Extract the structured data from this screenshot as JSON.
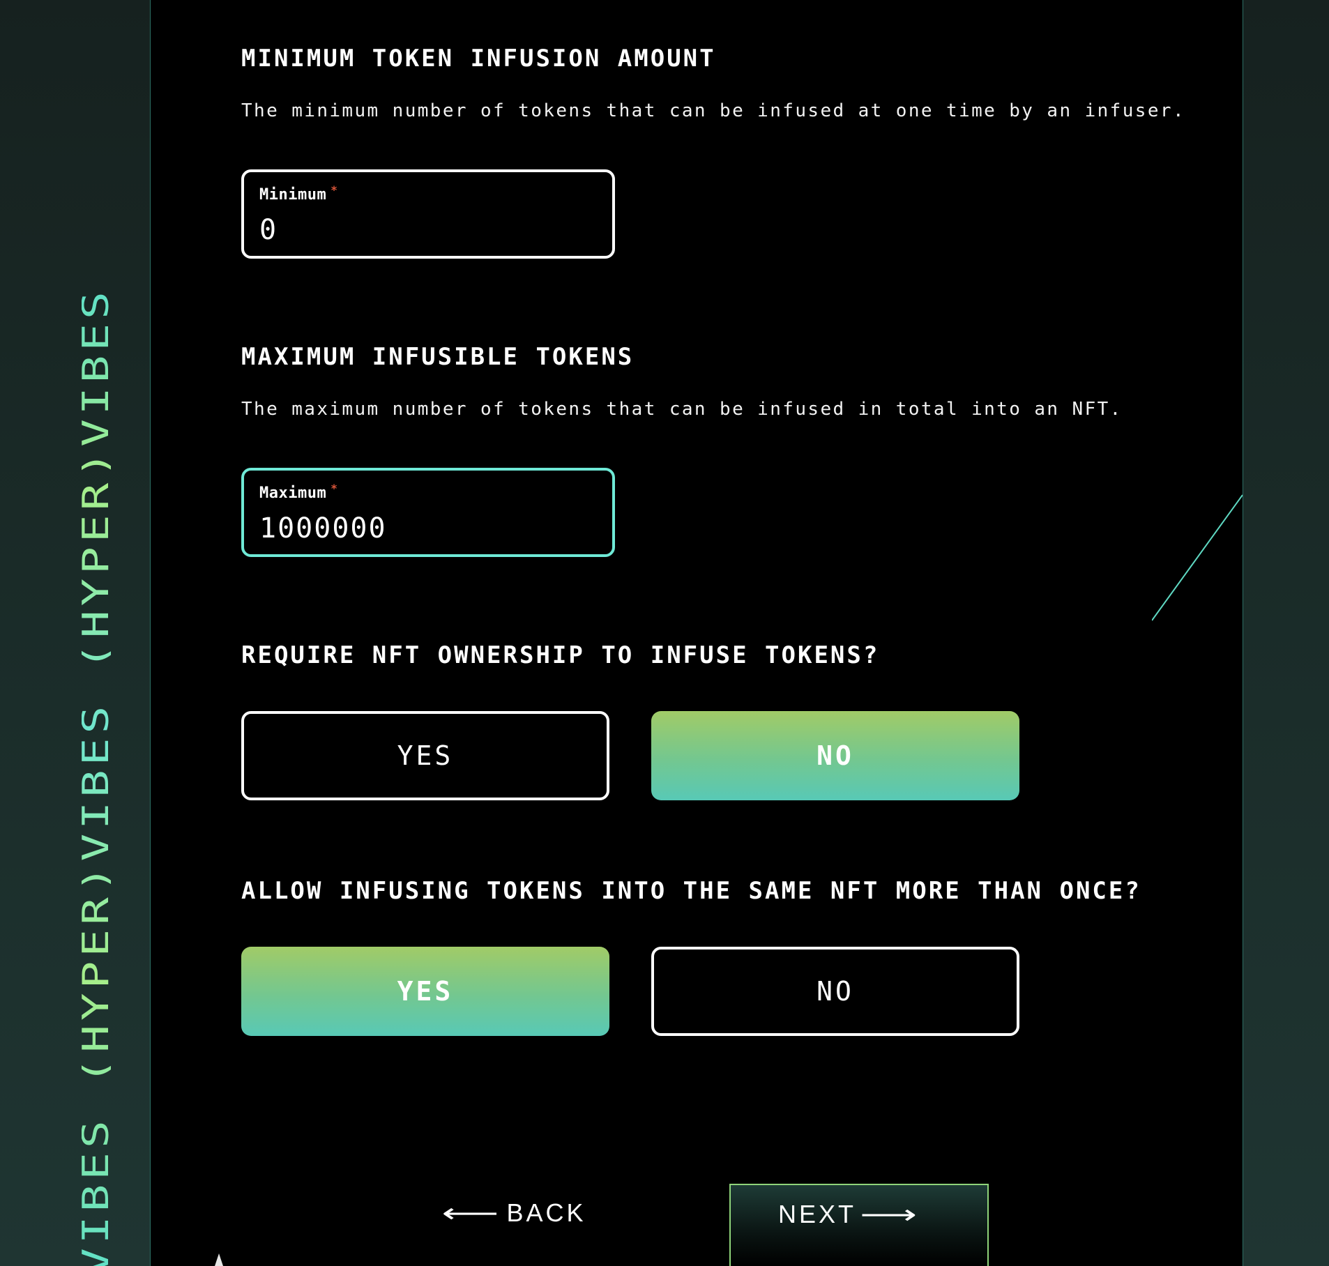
{
  "brand": {
    "vertical_text": "VIBES (HYPER)VIBES (HYPER)VIBES"
  },
  "sections": {
    "min_infusion": {
      "heading": "MINIMUM TOKEN INFUSION AMOUNT",
      "description": "The minimum number of tokens that can be infused at one time by an infuser.",
      "field_label": "Minimum",
      "required_mark": "*",
      "value": "0"
    },
    "max_infusible": {
      "heading": "MAXIMUM INFUSIBLE TOKENS",
      "description": "The maximum number of tokens that can be infused in total into an NFT.",
      "field_label": "Maximum",
      "required_mark": "*",
      "value": "1000000"
    },
    "require_ownership": {
      "heading": "REQUIRE NFT OWNERSHIP TO INFUSE TOKENS?",
      "yes_label": "YES",
      "no_label": "NO",
      "selected": "NO"
    },
    "allow_multiple": {
      "heading": "ALLOW INFUSING TOKENS INTO THE SAME NFT MORE THAN ONCE?",
      "yes_label": "YES",
      "no_label": "NO",
      "selected": "YES"
    }
  },
  "footer": {
    "back_label": "BACK",
    "next_label": "NEXT",
    "back_arrow": "⟵",
    "next_arrow": "⟶"
  },
  "colors": {
    "accent_teal": "#6fe9d6",
    "accent_green": "#a1cb67",
    "required": "#d9553a",
    "panel_bg": "#000000"
  }
}
